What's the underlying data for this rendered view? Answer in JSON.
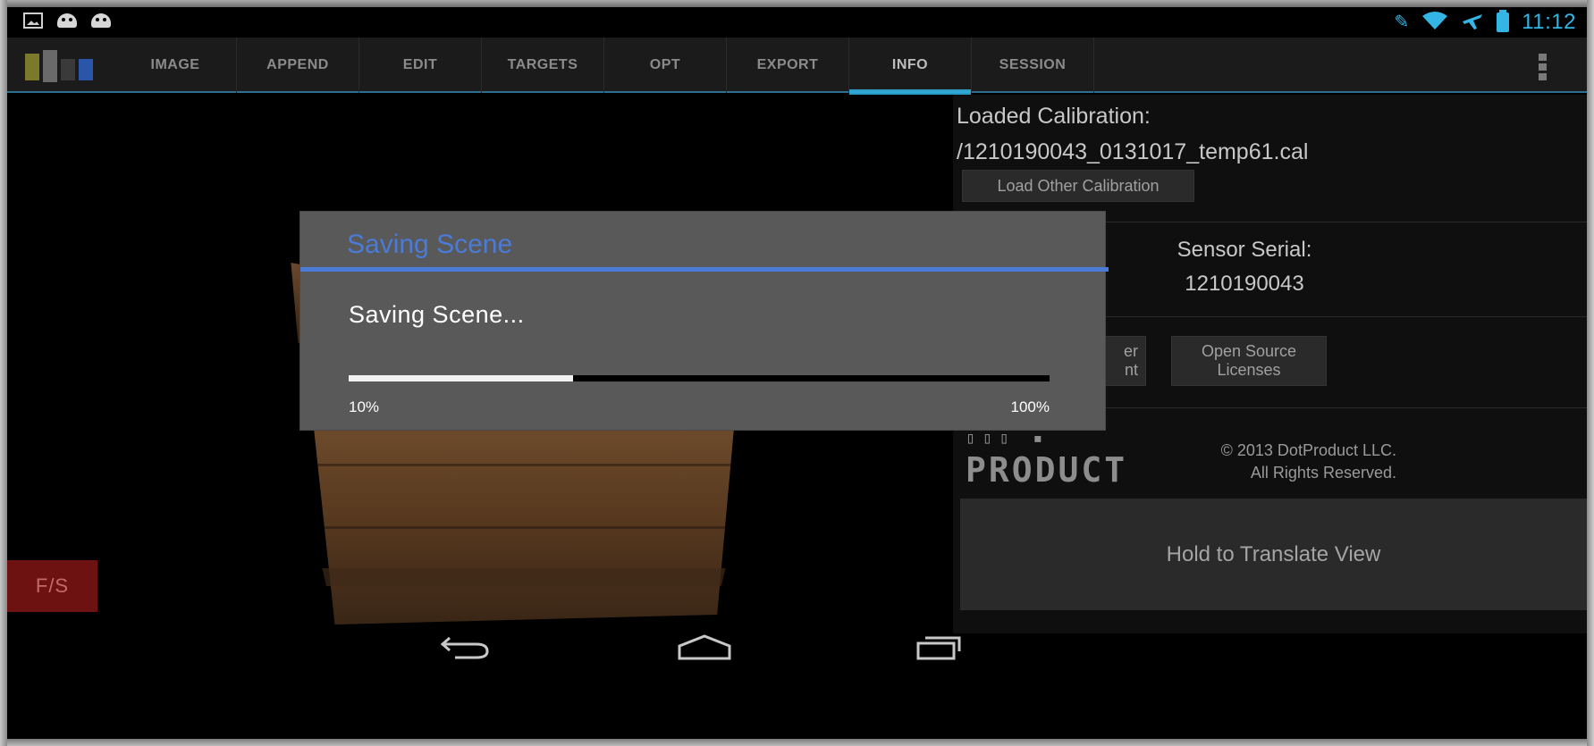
{
  "status_bar": {
    "left_icons": [
      "image-notification-icon",
      "android-notification-icon",
      "android-notification-icon"
    ],
    "right_icons": [
      "mute-icon",
      "wifi-icon",
      "airplane-icon",
      "battery-icon"
    ],
    "time": "11:12"
  },
  "action_bar": {
    "tabs": [
      {
        "label": "IMAGE"
      },
      {
        "label": "APPEND"
      },
      {
        "label": "EDIT"
      },
      {
        "label": "TARGETS"
      },
      {
        "label": "OPT"
      },
      {
        "label": "EXPORT"
      },
      {
        "label": "INFO",
        "active": true
      },
      {
        "label": "SESSION"
      }
    ],
    "overflow_icon": "overflow-menu-icon"
  },
  "viewport": {
    "fs_button": "F/S"
  },
  "info_panel": {
    "loaded_calibration_label": "Loaded Calibration:",
    "calibration_file": "/1210190043_0131017_temp61.cal",
    "load_other_button": "Load Other Calibration",
    "sensor_serial_label": "Sensor Serial:",
    "sensor_serial_value": "1210190043",
    "partial_button_line1": "er",
    "partial_button_line2": "nt",
    "licenses_button_line1": "Open Source",
    "licenses_button_line2": "Licenses",
    "logo_text": "PRODUCT",
    "copyright_line1": "© 2013 DotProduct LLC.",
    "copyright_line2": "All Rights Reserved.",
    "translate_button": "Hold to Translate View"
  },
  "dialog": {
    "title": "Saving Scene",
    "message": "Saving Scene...",
    "progress_fraction": 0.32,
    "progress_min_label": "10%",
    "progress_max_label": "100%"
  },
  "nav_bar": {
    "icons": [
      "back-icon",
      "home-icon",
      "recent-apps-icon"
    ]
  },
  "colors": {
    "accent_blue": "#33b5e5",
    "dialog_title": "#4a7bd6",
    "fs_button_bg": "#6e1111"
  }
}
